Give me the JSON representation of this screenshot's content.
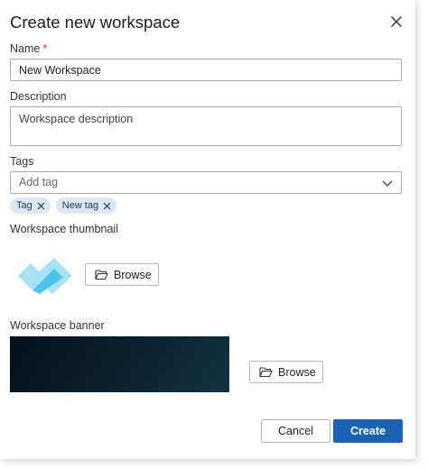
{
  "dialog": {
    "title": "Create new workspace",
    "close_icon": "close-icon"
  },
  "fields": {
    "name": {
      "label": "Name",
      "required_marker": "*",
      "value": "New Workspace"
    },
    "description": {
      "label": "Description",
      "value": "Workspace description"
    },
    "tags": {
      "label": "Tags",
      "placeholder": "Add tag",
      "chevron_icon": "chevron-down-icon",
      "items": [
        {
          "label": "Tag"
        },
        {
          "label": "New tag"
        }
      ]
    },
    "thumbnail": {
      "label": "Workspace thumbnail",
      "logo_icon": "workspace-logo-icon",
      "browse_label": "Browse",
      "browse_icon": "folder-open-icon"
    },
    "banner": {
      "label": "Workspace banner",
      "browse_label": "Browse",
      "browse_icon": "folder-open-icon"
    }
  },
  "footer": {
    "cancel_label": "Cancel",
    "create_label": "Create"
  },
  "colors": {
    "accent": "#1a63b4",
    "required": "#d0282c",
    "tag_background": "#dbe8f6",
    "logo_light": "#a8e2f6",
    "logo_dark": "#4cc4ec",
    "banner_dark": "#05101a"
  }
}
